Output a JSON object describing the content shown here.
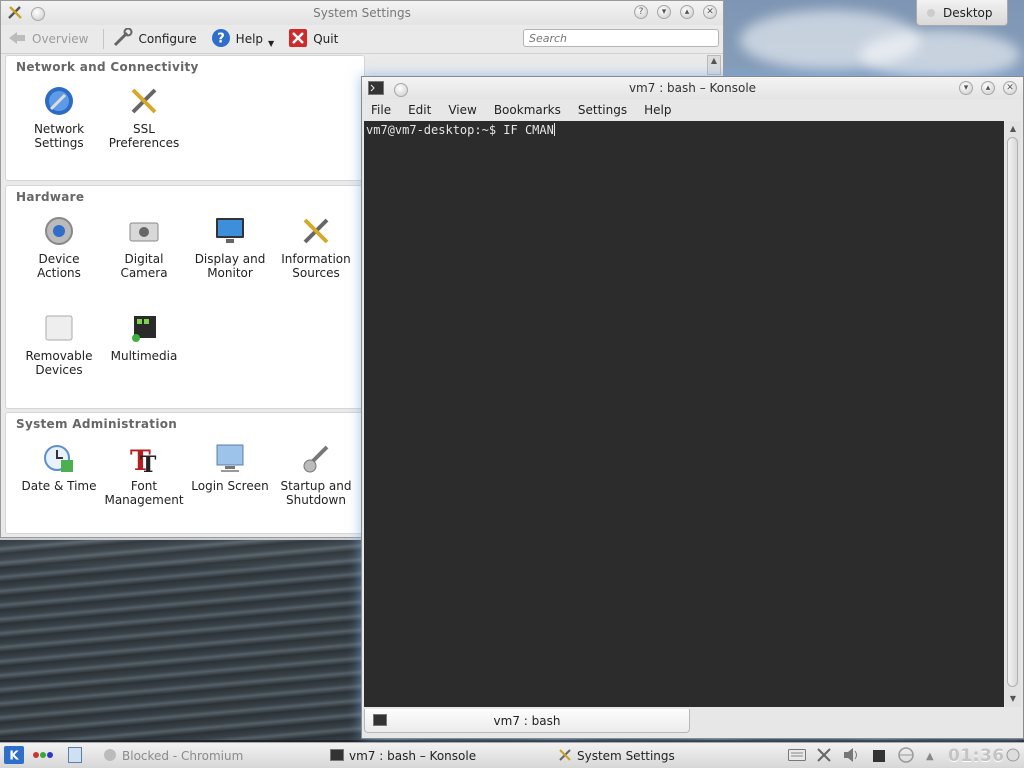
{
  "desktop": {
    "label": "Desktop"
  },
  "system_settings": {
    "title": "System Settings",
    "toolbar": {
      "overview": "Overview",
      "configure": "Configure",
      "help": "Help",
      "quit": "Quit",
      "search_placeholder": "Search"
    },
    "groups": [
      {
        "title": "Network and Connectivity",
        "items": [
          {
            "label": "Network\nSettings",
            "icon": "network-settings-icon"
          },
          {
            "label": "SSL\nPreferences",
            "icon": "ssl-preferences-icon"
          }
        ]
      },
      {
        "title": "Hardware",
        "items": [
          {
            "label": "Device\nActions",
            "icon": "device-actions-icon"
          },
          {
            "label": "Digital\nCamera",
            "icon": "camera-icon"
          },
          {
            "label": "Display and\nMonitor",
            "icon": "monitor-icon"
          },
          {
            "label": "Information\nSources",
            "icon": "information-sources-icon"
          },
          {
            "label": "Removable\nDevices",
            "icon": "removable-devices-icon"
          },
          {
            "label": "Multimedia",
            "icon": "multimedia-icon"
          }
        ]
      },
      {
        "title": "System Administration",
        "items": [
          {
            "label": "Date & Time",
            "icon": "clock-icon"
          },
          {
            "label": "Font\nManagement",
            "icon": "font-icon"
          },
          {
            "label": "Login Screen",
            "icon": "login-screen-icon"
          },
          {
            "label": "Startup and\nShutdown",
            "icon": "startup-shutdown-icon"
          }
        ]
      }
    ]
  },
  "konsole": {
    "title": "vm7 : bash – Konsole",
    "menu": [
      "File",
      "Edit",
      "View",
      "Bookmarks",
      "Settings",
      "Help"
    ],
    "prompt": "vm7@vm7-desktop:~$ IF CMAN",
    "tab_label": "vm7 : bash"
  },
  "taskbar": {
    "tasks": [
      {
        "label": "Blocked - Chromium",
        "active": false
      },
      {
        "label": "vm7 : bash – Konsole",
        "active": true
      },
      {
        "label": "System Settings",
        "active": false
      }
    ],
    "clock": "01:36"
  },
  "colors": {
    "terminal_bg": "#2c2c2c",
    "terminal_fg": "#e6e6e6",
    "glow": "#78aae6"
  }
}
